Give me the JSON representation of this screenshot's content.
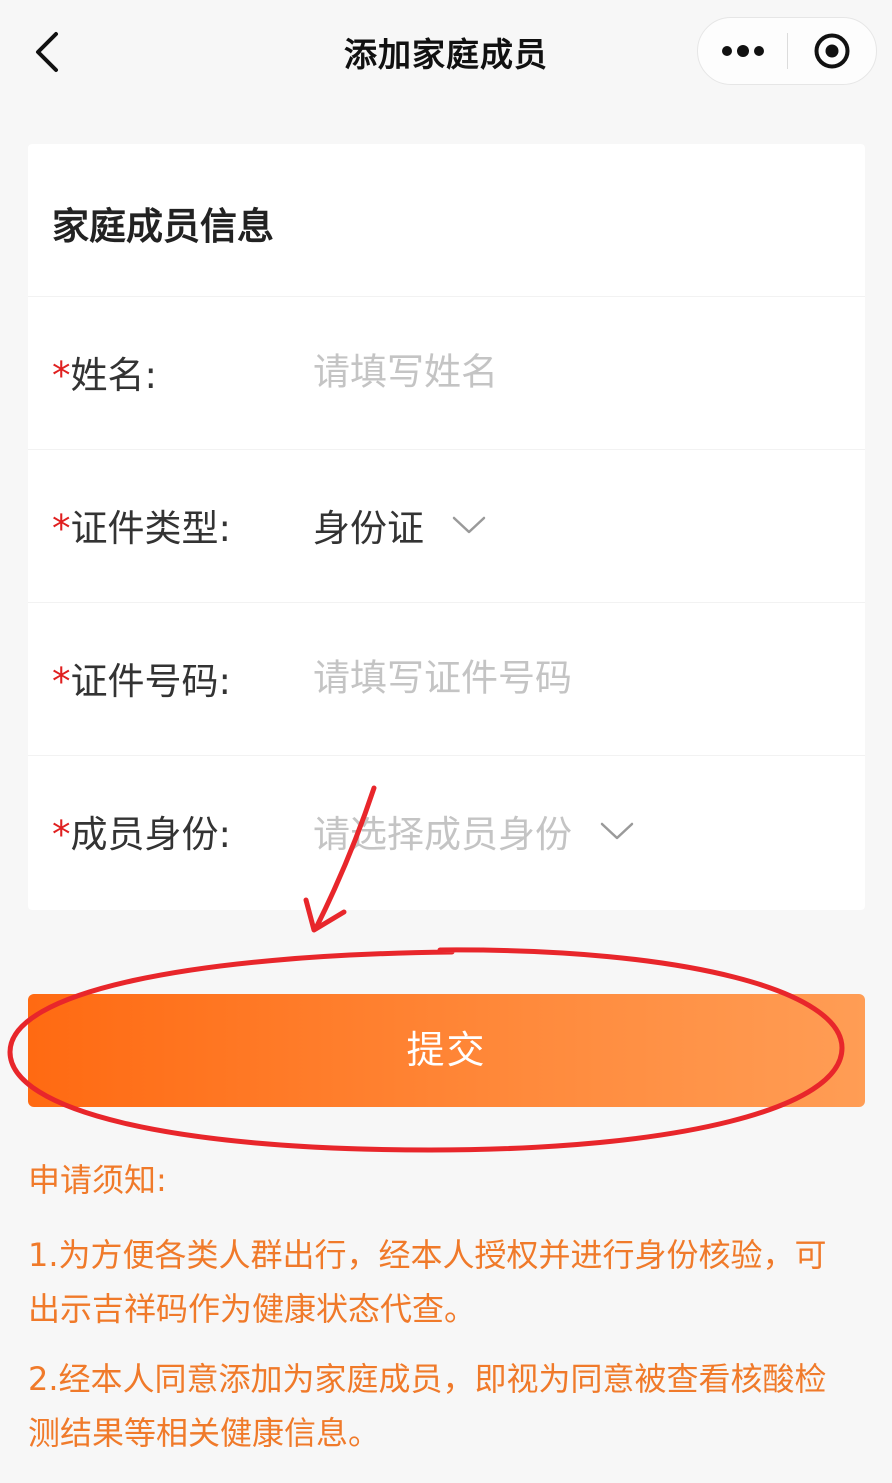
{
  "navbar": {
    "title": "添加家庭成员",
    "back_icon": "chevron-left-icon",
    "more_icon": "more-dots-icon",
    "close_icon": "target-circle-icon"
  },
  "card": {
    "title": "家庭成员信息",
    "required_mark": "*",
    "fields": [
      {
        "label": "姓名:",
        "type": "input",
        "placeholder": "请填写姓名",
        "value": ""
      },
      {
        "label": "证件类型:",
        "type": "select",
        "value": "身份证"
      },
      {
        "label": "证件号码:",
        "type": "input",
        "placeholder": "请填写证件号码",
        "value": ""
      },
      {
        "label": "成员身份:",
        "type": "select",
        "placeholder": "请选择成员身份",
        "value": ""
      }
    ]
  },
  "submit": {
    "label": "提交"
  },
  "notice": {
    "title": "申请须知:",
    "items": [
      "1.为方便各类人群出行，经本人授权并进行身份核验，可出示吉祥码作为健康状态代查。",
      "2.经本人同意添加为家庭成员，即视为同意被查看核酸检测结果等相关健康信息。"
    ]
  },
  "colors": {
    "accent": "#ff7a22",
    "notice_text": "#f07a2a",
    "required": "#e02020",
    "annotation": "#e8262b"
  }
}
